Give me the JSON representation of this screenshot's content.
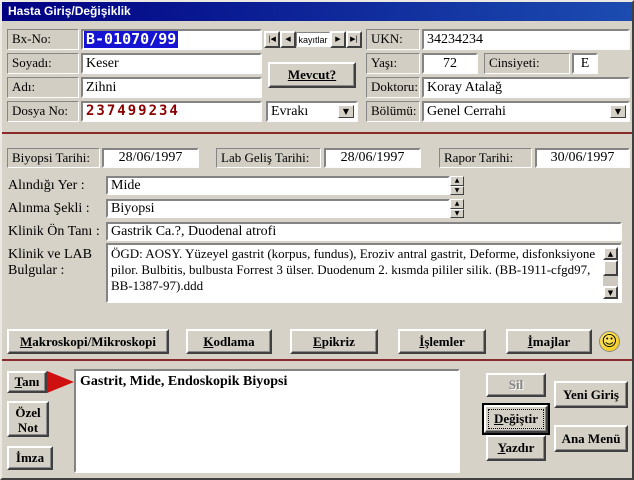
{
  "window": {
    "title": "Hasta Giriş/Değişiklik"
  },
  "icons": {
    "nav_first": "|◀",
    "nav_prev": "◀",
    "nav_next": "▶",
    "nav_last": "▶|",
    "combo_arrow": "▼",
    "spin_up": "▲",
    "spin_down": "▼",
    "scroll_up": "▲",
    "scroll_down": "▼",
    "smiley": "☺"
  },
  "colors": {
    "titlebar": "#000082",
    "separator": "#8b2a2a",
    "selection_highlight": "#1414d2",
    "dosya_no_text": "#8b0000",
    "smiley_yellow": "#f2c410",
    "arrow_red": "#cf1010"
  },
  "top": {
    "bxno_label": "Bx-No:",
    "bxno_value": "B-01070/99",
    "records_label": "kayıtlar",
    "ukn_label": "UKN:",
    "ukn_value": "34234234",
    "soyadi_label": "Soyadı:",
    "soyadi_value": "Keser",
    "mevcut_button": "Mevcut?",
    "yasi_label": "Yaşı:",
    "yasi_value": "72",
    "cinsiyeti_label": "Cinsiyeti:",
    "cinsiyeti_value": "E",
    "adi_label": "Adı:",
    "adi_value": "Zihni",
    "doktoru_label": "Doktoru:",
    "doktoru_value": "Koray Atalağ",
    "dosya_no_label": "Dosya No:",
    "dosya_no_value": "237499234",
    "evraki_combo": "Evrakı",
    "bolumu_label": "Bölümü:",
    "bolumu_value": "Genel Cerrahi"
  },
  "dates": {
    "biyopsi_label": "Biyopsi Tarihi:",
    "biyopsi_value": "28/06/1997",
    "lab_gelis_label": "Lab Geliş Tarihi:",
    "lab_gelis_value": "28/06/1997",
    "rapor_label": "Rapor Tarihi:",
    "rapor_value": "30/06/1997"
  },
  "specimen": {
    "alindigi_yer_label": "Alındığı Yer :",
    "alindigi_yer_value": "Mide",
    "alinma_sekli_label": "Alınma Şekli :",
    "alinma_sekli_value": "Biyopsi",
    "klinik_on_tani_label": "Klinik Ön Tanı :",
    "klinik_on_tani_value": "Gastrik Ca.?, Duodenal atrofi",
    "bulgular_label": "Klinik ve LAB Bulgular :",
    "bulgular_value": "ÖGD: AOSY. Yüzeyel gastrit (korpus, fundus), Eroziv antral gastrit, Deforme, disfonksiyone pilor. Bulbitis, bulbusta Forrest 3 ülser. Duodenum 2. kısmda pililer silik. (BB-1911-cfgd97, BB-1387-97).ddd"
  },
  "actions": {
    "makroskopi": "Makroskopi/Mikroskopi",
    "kodlama": "Kodlama",
    "epikriz": "Epikriz",
    "islemler": "İşlemler",
    "imajlar": "İmajlar"
  },
  "bottom": {
    "tani_button": "Tanı",
    "tani_text": "Gastrit, Mide, Endoskopik Biyopsi",
    "ozel_not_button": "Özel Not",
    "imza_button": "İmza",
    "sil_button": "Sil",
    "yeni_giris_button": "Yeni Giriş",
    "degistir_button": "Değiştir",
    "yazdir_button": "Yazdır",
    "ana_menu_button": "Ana Menü"
  }
}
